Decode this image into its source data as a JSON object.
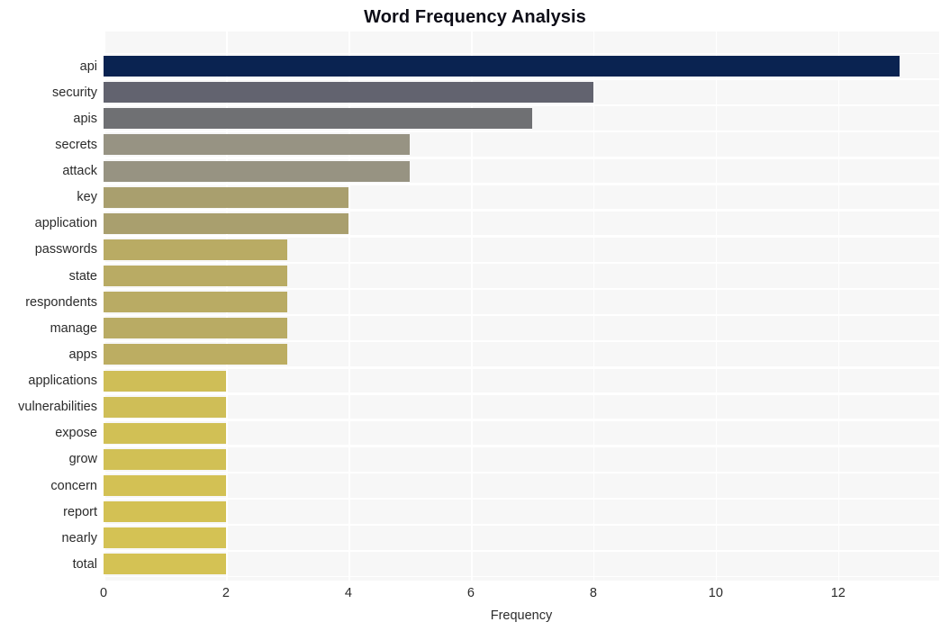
{
  "chart_data": {
    "type": "bar",
    "orientation": "horizontal",
    "title": "Word Frequency Analysis",
    "xlabel": "Frequency",
    "ylabel": "",
    "categories": [
      "api",
      "security",
      "apis",
      "secrets",
      "attack",
      "key",
      "application",
      "passwords",
      "state",
      "respondents",
      "manage",
      "apps",
      "applications",
      "vulnerabilities",
      "expose",
      "grow",
      "concern",
      "report",
      "nearly",
      "total"
    ],
    "values": [
      13,
      8,
      7,
      5,
      5,
      4,
      4,
      3,
      3,
      3,
      3,
      3,
      2,
      2,
      2,
      2,
      2,
      2,
      2,
      2
    ],
    "bar_colors": [
      "#0a2351",
      "#62636f",
      "#6f7073",
      "#979383",
      "#979382",
      "#a99f6e",
      "#a99f6e",
      "#b9ab64",
      "#b9ab64",
      "#b9ab64",
      "#b9ab64",
      "#bcad62",
      "#cfbe57",
      "#cfbe57",
      "#d1c055",
      "#d1c055",
      "#d3c154",
      "#d3c154",
      "#d4c254",
      "#d4c254"
    ],
    "xlim": [
      0,
      13.65
    ],
    "xticks": [
      0,
      2,
      4,
      6,
      8,
      10,
      12
    ],
    "xtick_labels": [
      "0",
      "2",
      "4",
      "6",
      "8",
      "10",
      "12"
    ],
    "grid": true,
    "grid_color": "#ffffff",
    "plot_background": "#f7f7f7",
    "figure_background": "#ffffff",
    "legend": null,
    "title_color": "#0d0d17",
    "tick_color": "#2b2b2b"
  }
}
